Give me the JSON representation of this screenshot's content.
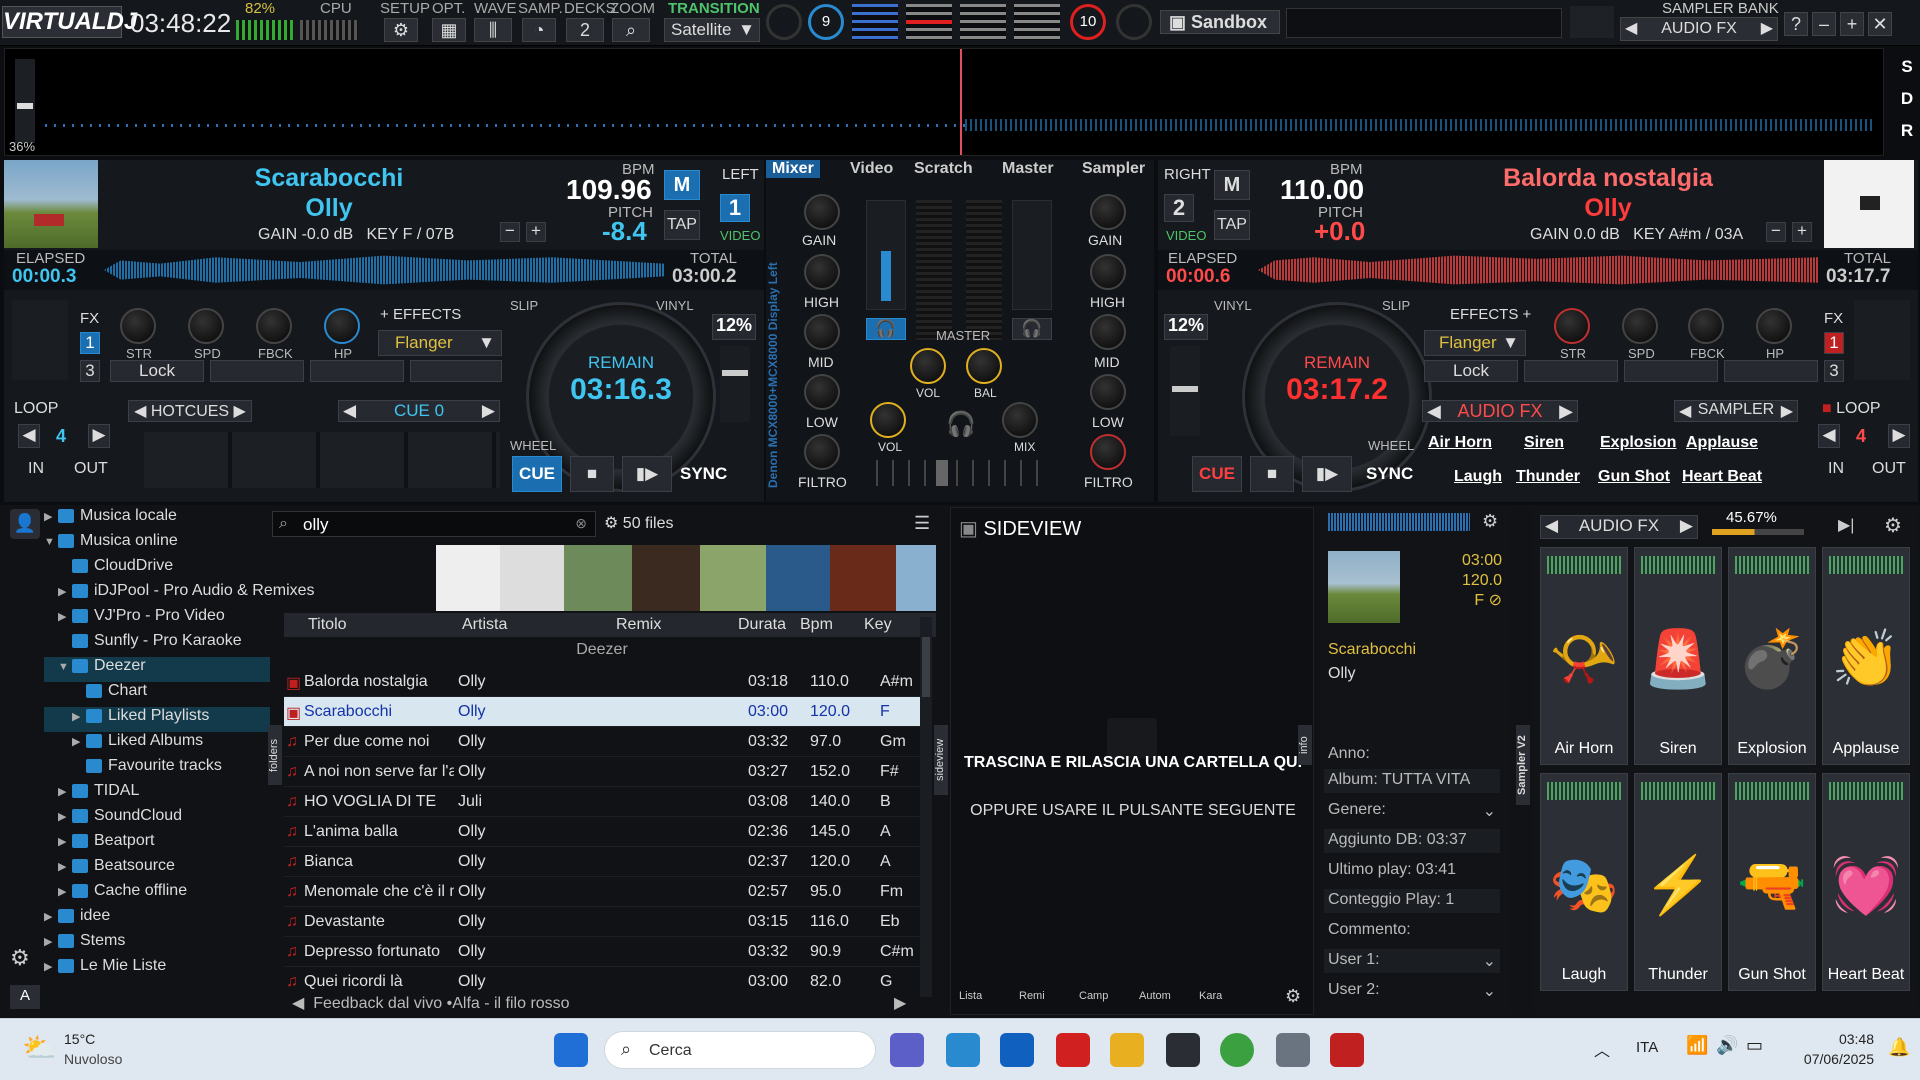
{
  "app": {
    "logo": "VIRTUALDJ",
    "clock": "03:48:22",
    "battery": "82%",
    "cpu": "CPU",
    "setup": "SETUP",
    "opt": "OPT.",
    "wave": "WAVE",
    "samp": "SAMP.",
    "decks": "DECKS",
    "decks_val": "2",
    "zoom": "ZOOM",
    "transition": "TRANSITION",
    "transition_val": "Satellite",
    "num9": "9",
    "num10": "10",
    "sandbox": "Sandbox",
    "sampler_bank": "SAMPLER BANK",
    "sampler_bank_val": "AUDIO FX",
    "zoom_pct": "36%",
    "sdr": [
      "S",
      "D",
      "R"
    ]
  },
  "deck_left": {
    "title": "Scarabocchi",
    "artist": "Olly",
    "gain": "GAIN -0.0 dB",
    "key": "KEY F / 07B",
    "bpm_label": "BPM",
    "bpm": "109.96",
    "pitch_label": "PITCH",
    "pitch": "-8.4",
    "m": "M",
    "tap": "TAP",
    "side": "LEFT",
    "deck_num": "1",
    "video": "VIDEO",
    "elapsed_label": "ELAPSED",
    "elapsed": "00:00.3",
    "total_label": "TOTAL",
    "total": "03:00.2",
    "fx": "FX",
    "fx1": "1",
    "fx3": "3",
    "str": "STR",
    "spd": "SPD",
    "fbck": "FBCK",
    "hp": "HP",
    "effects": "EFFECTS",
    "effect_val": "Flanger",
    "lock": "Lock",
    "slip": "SLIP",
    "vinyl": "VINYL",
    "remain_label": "REMAIN",
    "remain": "03:16.3",
    "pct": "12%",
    "wheel": "WHEEL",
    "cue": "CUE",
    "sync": "SYNC",
    "loop": "LOOP",
    "loop_val": "4",
    "in": "IN",
    "out": "OUT",
    "hotcues": "HOTCUES",
    "cue0": "CUE 0"
  },
  "mixer": {
    "tabs": [
      "Mixer",
      "Video",
      "Scratch",
      "Master",
      "Sampler"
    ],
    "gain": "GAIN",
    "high": "HIGH",
    "mid": "MID",
    "low": "LOW",
    "filtro": "FILTRO",
    "master": "MASTER",
    "vol": "VOL",
    "bal": "BAL",
    "mix": "MIX",
    "vertical": "Denon MCX8000+MCX8000 Display Left"
  },
  "deck_right": {
    "title": "Balorda nostalgia",
    "artist": "Olly",
    "gain": "GAIN 0.0 dB",
    "key": "KEY A#m / 03A",
    "bpm_label": "BPM",
    "bpm": "110.00",
    "pitch_label": "PITCH",
    "pitch": "+0.0",
    "m": "M",
    "tap": "TAP",
    "side": "RIGHT",
    "deck_num": "2",
    "video": "VIDEO",
    "elapsed_label": "ELAPSED",
    "elapsed": "00:00.6",
    "total_label": "TOTAL",
    "total": "03:17.7",
    "fx": "FX",
    "fx1": "1",
    "fx3": "3",
    "effects": "EFFECTS",
    "effect_val": "Flanger",
    "lock": "Lock",
    "str": "STR",
    "spd": "SPD",
    "fbck": "FBCK",
    "hp": "HP",
    "slip": "SLIP",
    "vinyl": "VINYL",
    "remain_label": "REMAIN",
    "remain": "03:17.2",
    "pct": "12%",
    "wheel": "WHEEL",
    "cue": "CUE",
    "sync": "SYNC",
    "loop": "LOOP",
    "loop_val": "4",
    "in": "IN",
    "out": "OUT",
    "audiofx": "AUDIO FX",
    "sampler": "SAMPLER",
    "samples": [
      "Air Horn",
      "Siren",
      "Explosion",
      "Applause",
      "Laugh",
      "Thunder",
      "Gun Shot",
      "Heart Beat"
    ]
  },
  "tree": [
    {
      "label": "Musica locale",
      "ind": 0,
      "exp": "▶"
    },
    {
      "label": "Musica online",
      "ind": 0,
      "exp": "▼"
    },
    {
      "label": "CloudDrive",
      "ind": 1,
      "exp": ""
    },
    {
      "label": "iDJPool - Pro Audio & Remixes",
      "ind": 1,
      "exp": "▶"
    },
    {
      "label": "VJ'Pro - Pro Video",
      "ind": 1,
      "exp": "▶"
    },
    {
      "label": "Sunfly - Pro Karaoke",
      "ind": 1,
      "exp": ""
    },
    {
      "label": "Deezer",
      "ind": 1,
      "exp": "▼"
    },
    {
      "label": "Chart",
      "ind": 2,
      "exp": ""
    },
    {
      "label": "Liked Playlists",
      "ind": 2,
      "exp": "▶"
    },
    {
      "label": "Liked Albums",
      "ind": 2,
      "exp": "▶"
    },
    {
      "label": "Favourite tracks",
      "ind": 2,
      "exp": ""
    },
    {
      "label": "TIDAL",
      "ind": 1,
      "exp": "▶"
    },
    {
      "label": "SoundCloud",
      "ind": 1,
      "exp": "▶"
    },
    {
      "label": "Beatport",
      "ind": 1,
      "exp": "▶"
    },
    {
      "label": "Beatsource",
      "ind": 1,
      "exp": "▶"
    },
    {
      "label": "Cache offline",
      "ind": 1,
      "exp": "▶"
    },
    {
      "label": "idee",
      "ind": 0,
      "exp": "▶"
    },
    {
      "label": "Stems",
      "ind": 0,
      "exp": "▶"
    },
    {
      "label": "Le Mie Liste",
      "ind": 0,
      "exp": "▶"
    }
  ],
  "search": {
    "value": "olly",
    "files": "50 files",
    "folders": "folders",
    "sideview_tab": "sideview"
  },
  "columns": [
    "Titolo",
    "Artista",
    "Remix",
    "Durata",
    "Bpm",
    "Key"
  ],
  "group": "Deezer",
  "rows": [
    [
      "Balorda nostalgia",
      "Olly",
      "03:18",
      "110.0",
      "A#m"
    ],
    [
      "Scarabocchi",
      "Olly",
      "03:00",
      "120.0",
      "F"
    ],
    [
      "Per due come noi",
      "Olly",
      "03:32",
      "97.0",
      "Gm"
    ],
    [
      "A noi non serve far l'amore",
      "Olly",
      "03:27",
      "152.0",
      "F#"
    ],
    [
      "HO VOGLIA DI TE",
      "Juli",
      "03:08",
      "140.0",
      "B"
    ],
    [
      "L'anima balla",
      "Olly",
      "02:36",
      "145.0",
      "A"
    ],
    [
      "Bianca",
      "Olly",
      "02:37",
      "120.0",
      "A"
    ],
    [
      "Menomale che c'è il mare",
      "Olly",
      "02:57",
      "95.0",
      "Fm"
    ],
    [
      "Devastante",
      "Olly",
      "03:15",
      "116.0",
      "Eb"
    ],
    [
      "Depresso fortunato",
      "Olly",
      "03:32",
      "90.9",
      "C#m"
    ],
    [
      "Quei ricordi là",
      "Olly",
      "03:00",
      "82.0",
      "G"
    ]
  ],
  "feedback": "Feedback dal vivo •Alfa - il filo rosso",
  "sideview": {
    "title": "SIDEVIEW",
    "drop": "TRASCINA E RILASCIA UNA CARTELLA QUI",
    "or": "OPPURE USARE IL PULSANTE SEGUENTE",
    "info_tab": "info",
    "tools": [
      "Lista",
      "Remi",
      "Camp",
      "Autom",
      "Kara"
    ]
  },
  "info": {
    "time": "03:00",
    "bpm": "120.0",
    "key": "F",
    "title": "Scarabocchi",
    "artist": "Olly",
    "anno": "Anno:",
    "album": "Album: TUTTA VITA",
    "genere": "Genere:",
    "aggiunto": "Aggiunto DB: 03:37",
    "ultimo": "Ultimo play: 03:41",
    "conteggio": "Conteggio Play: 1",
    "commento": "Commento:",
    "user1": "User 1:",
    "user2": "User 2:"
  },
  "sampler": {
    "label": "AUDIO FX",
    "vol": "45.67%",
    "vtab": "Sampler V2",
    "pads": [
      "Air Horn",
      "Siren",
      "Explosion",
      "Applause",
      "Laugh",
      "Thunder",
      "Gun Shot",
      "Heart Beat"
    ],
    "icons": [
      "air-horn-icon",
      "siren-icon",
      "explosion-icon",
      "applause-icon",
      "laugh-icon",
      "thunder-icon",
      "gun-shot-icon",
      "heart-beat-icon"
    ]
  },
  "taskbar": {
    "temp": "15°C",
    "weather": "Nuvoloso",
    "search": "Cerca",
    "lang": "ITA",
    "time": "03:48",
    "date": "07/06/2025"
  }
}
